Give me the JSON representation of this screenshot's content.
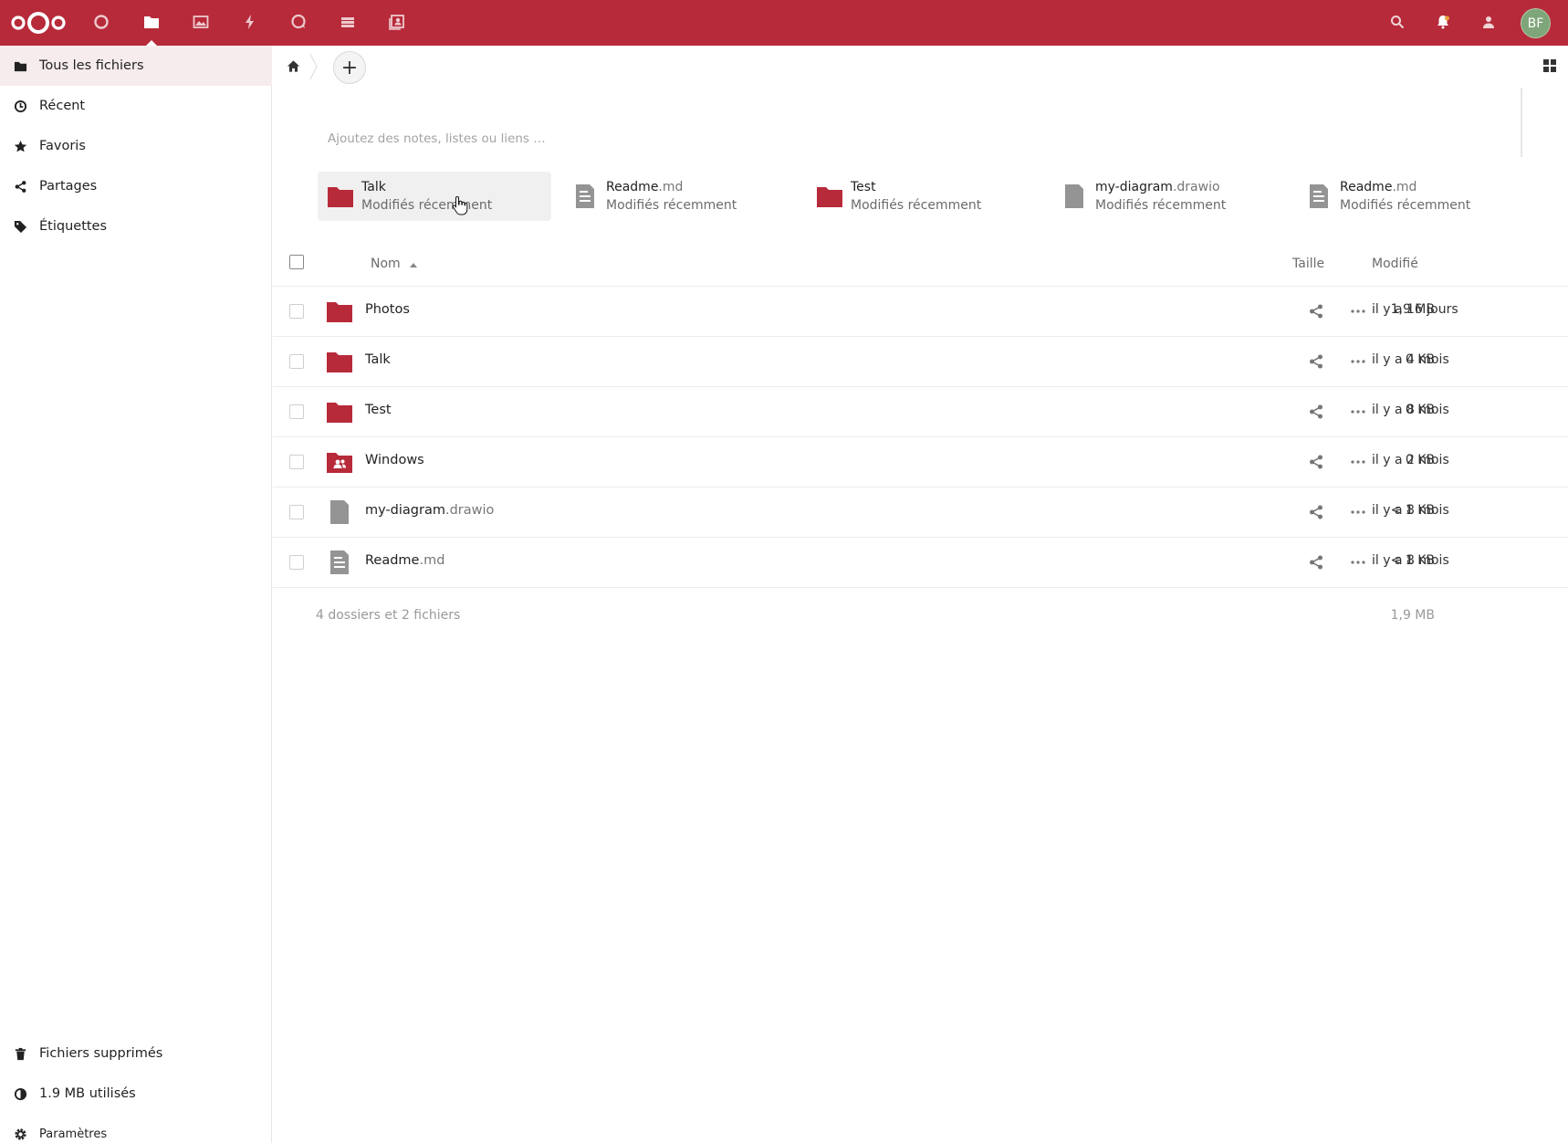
{
  "header": {
    "brand_color": "#b72a3a",
    "apps": [
      {
        "name": "dashboard",
        "icon": "circle-icon"
      },
      {
        "name": "files",
        "icon": "folder-icon",
        "active": true
      },
      {
        "name": "photos",
        "icon": "image-icon"
      },
      {
        "name": "activity",
        "icon": "lightning-icon"
      },
      {
        "name": "talk",
        "icon": "speech-bubble-icon"
      },
      {
        "name": "deck",
        "icon": "stack-icon"
      },
      {
        "name": "contacts",
        "icon": "contacts-icon"
      }
    ],
    "avatar_initials": "BF",
    "avatar_color": "#7fa57a"
  },
  "sidebar": {
    "items": [
      {
        "label": "Tous les fichiers",
        "icon": "folder-icon",
        "active": true
      },
      {
        "label": "Récent",
        "icon": "clock-icon"
      },
      {
        "label": "Favoris",
        "icon": "star-icon"
      },
      {
        "label": "Partages",
        "icon": "share-icon"
      },
      {
        "label": "Étiquettes",
        "icon": "tag-icon"
      }
    ],
    "bottom": {
      "deleted": "Fichiers supprimés",
      "quota": "1.9 MB utilisés",
      "settings": "Paramètres"
    }
  },
  "main": {
    "add_label": "+",
    "notes_placeholder": "Ajoutez des notes, listes ou liens …",
    "recent": [
      {
        "name": "Talk",
        "ext": "",
        "sub": "Modifiés récemment",
        "type": "folder"
      },
      {
        "name": "Readme",
        "ext": ".md",
        "sub": "Modifiés récemment",
        "type": "text"
      },
      {
        "name": "Test",
        "ext": "",
        "sub": "Modifiés récemment",
        "type": "folder"
      },
      {
        "name": "my-diagram",
        "ext": ".drawio",
        "sub": "Modifiés récemment",
        "type": "file"
      },
      {
        "name": "Readme",
        "ext": ".md",
        "sub": "Modifiés récemment",
        "type": "text"
      }
    ],
    "columns": {
      "name": "Nom",
      "size": "Taille",
      "modified": "Modifié"
    },
    "files": [
      {
        "name": "Photos",
        "ext": "",
        "type": "folder",
        "size": "1,9 MB",
        "modified": "il y a 16 jours"
      },
      {
        "name": "Talk",
        "ext": "",
        "type": "folder",
        "size": "0 KB",
        "modified": "il y a 4 mois"
      },
      {
        "name": "Test",
        "ext": "",
        "type": "folder",
        "size": "0 KB",
        "modified": "il y a 8 mois"
      },
      {
        "name": "Windows",
        "ext": "",
        "type": "shared-folder",
        "size": "0 KB",
        "modified": "il y a 2 mois"
      },
      {
        "name": "my-diagram",
        "ext": ".drawio",
        "type": "file",
        "size": "< 1 KB",
        "modified": "il y a 8 mois"
      },
      {
        "name": "Readme",
        "ext": ".md",
        "type": "text",
        "size": "< 1 KB",
        "modified": "il y a 8 mois"
      }
    ],
    "summary": "4 dossiers et 2 fichiers",
    "summary_size": "1,9 MB"
  }
}
